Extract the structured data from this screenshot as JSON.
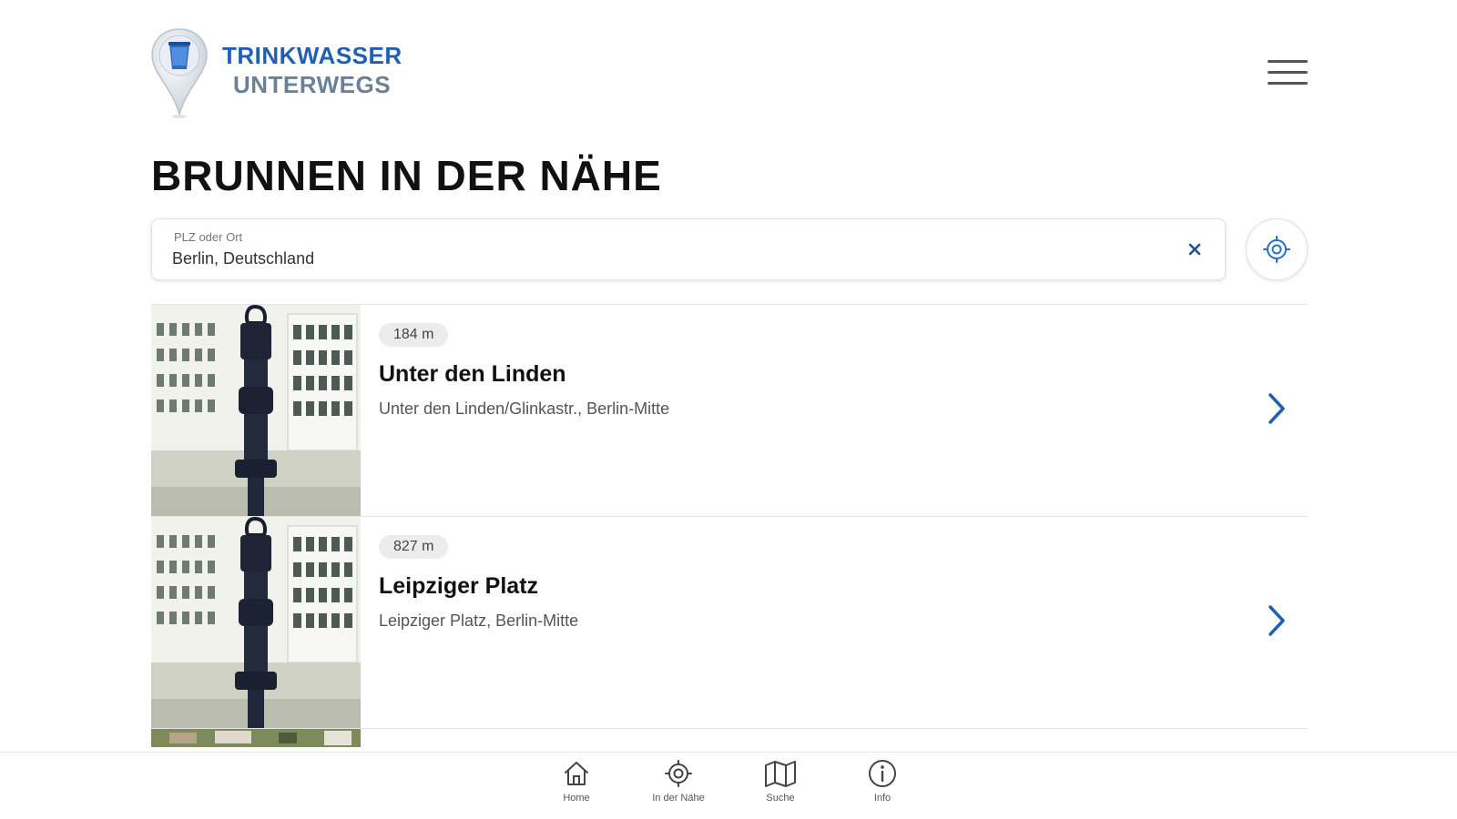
{
  "header": {
    "logo_line1": "TRINKWASSER",
    "logo_line2": "UNTERWEGS",
    "brand_color": "#1f5fb4",
    "menu_icon": "hamburger-menu-icon"
  },
  "page": {
    "title": "BRUNNEN IN DER NÄHE"
  },
  "search": {
    "label": "PLZ oder Ort",
    "value": "Berlin, Deutschland",
    "clear_icon": "close-icon",
    "locate_icon": "crosshair-location-icon"
  },
  "fountains": [
    {
      "distance": "184 m",
      "name": "Unter den Linden",
      "address": "Unter den Linden/Glinkastr., Berlin-Mitte"
    },
    {
      "distance": "827 m",
      "name": "Leipziger Platz",
      "address": "Leipziger Platz, Berlin-Mitte"
    }
  ],
  "nav": {
    "items": [
      {
        "label": "Home",
        "icon": "home-icon"
      },
      {
        "label": "In der Nähe",
        "icon": "crosshair-icon"
      },
      {
        "label": "Suche",
        "icon": "map-icon"
      },
      {
        "label": "Info",
        "icon": "info-icon"
      }
    ]
  },
  "colors": {
    "accent": "#1f5fb4",
    "chevron": "#1f5fb4",
    "badge_bg": "#ececec"
  }
}
